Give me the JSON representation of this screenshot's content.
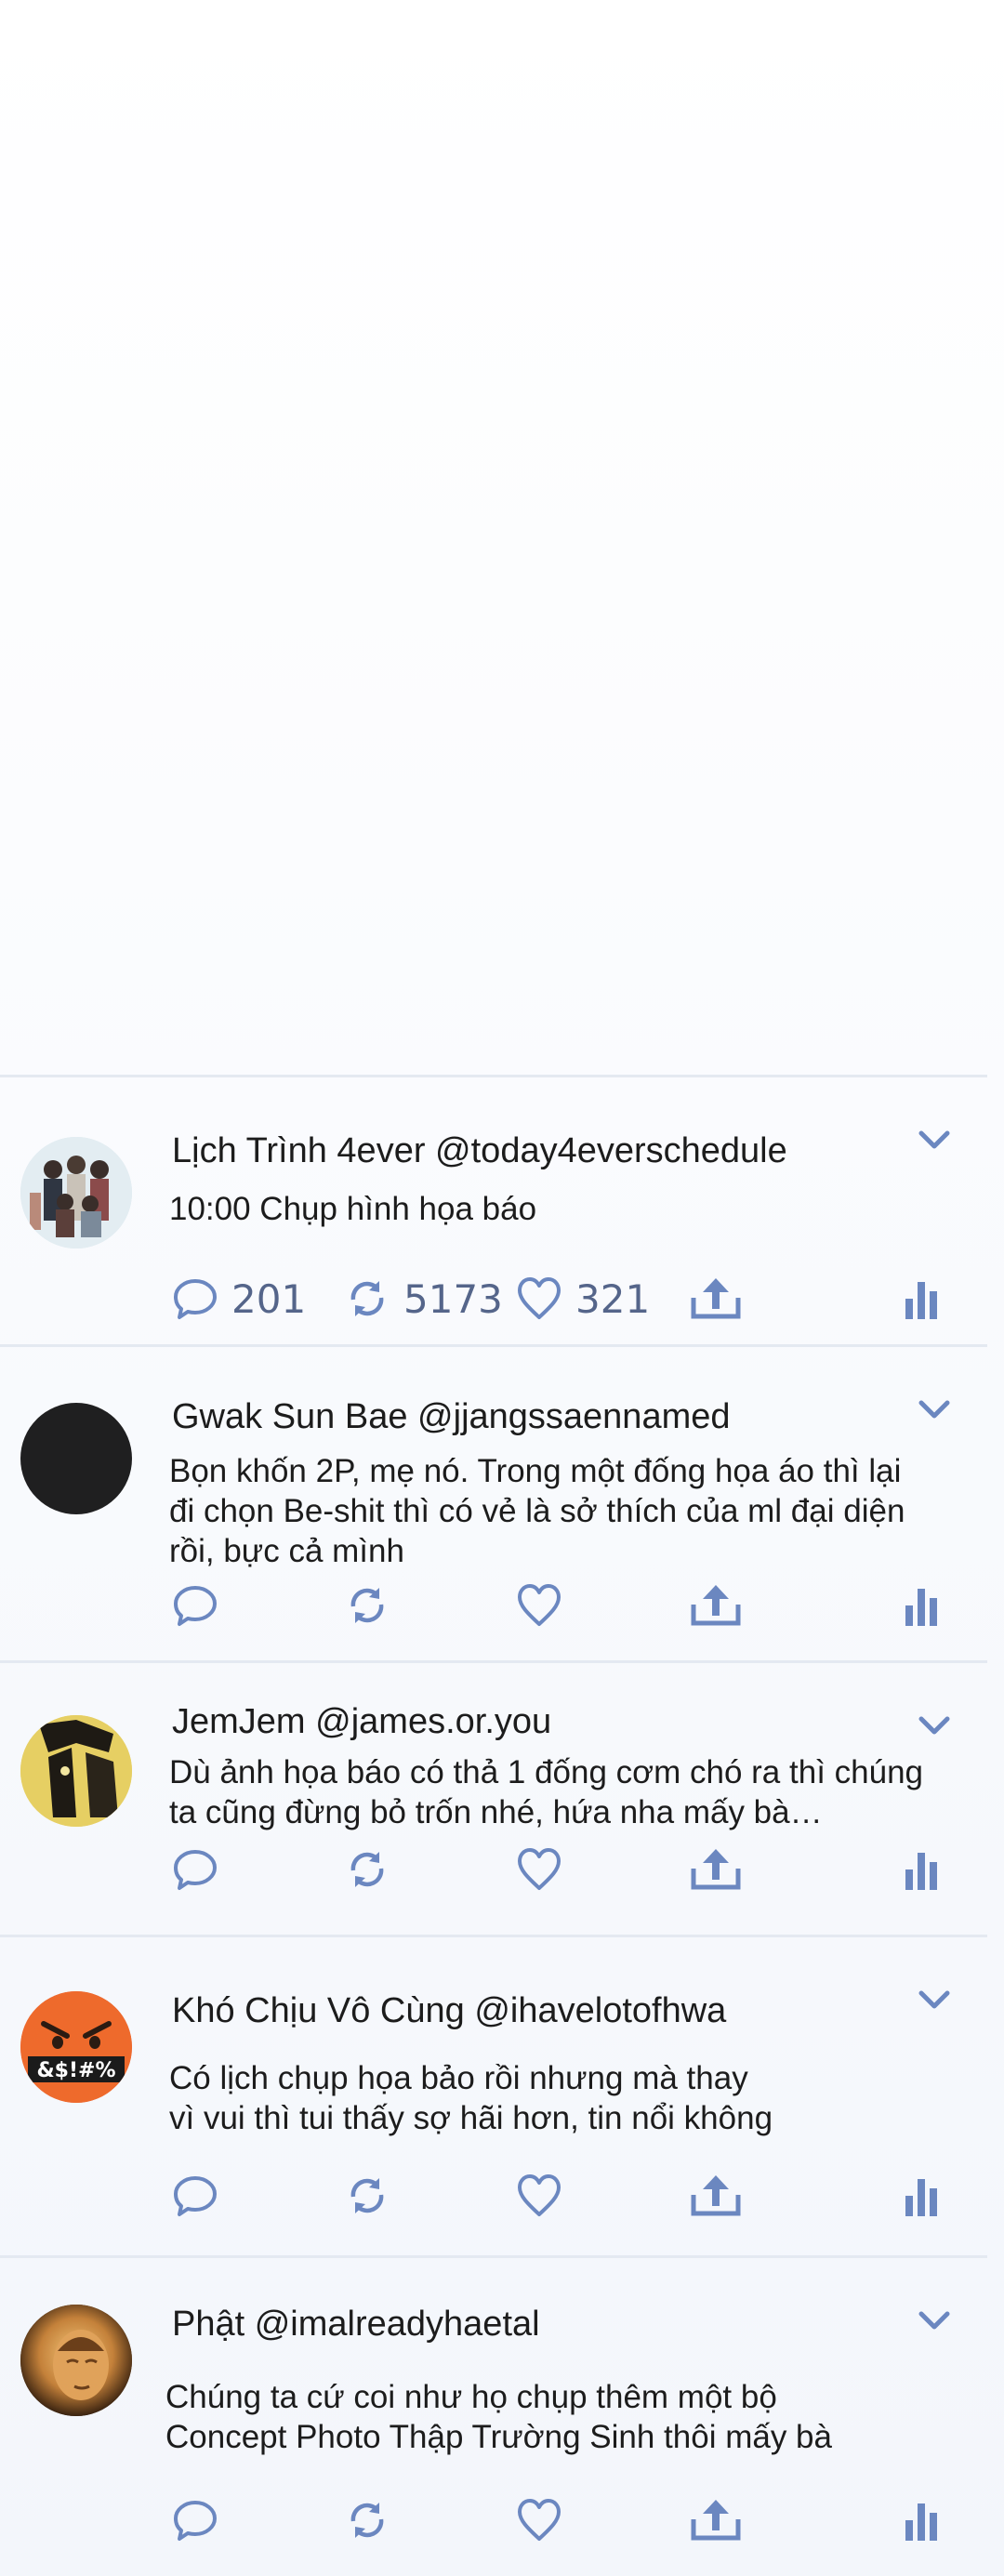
{
  "tweets": [
    {
      "name": "Lịch Trình 4ever",
      "handle": "@today4everschedule",
      "text": [
        "10:00 Chụp hình họa báo"
      ],
      "avatar": "group-photo-avatar",
      "stats": {
        "replies": "201",
        "retweets": "5173",
        "likes": "321"
      }
    },
    {
      "name": "Gwak Sun Bae",
      "handle": "@jjangssaennamed",
      "text": [
        "Bọn khốn 2P, mẹ nó. Trong một đống họa áo thì lại",
        "đi chọn Be-shit thì có vẻ là sở thích của ml đại diện",
        "rồi, bực cả mình"
      ],
      "avatar": "black-circle-avatar"
    },
    {
      "name": "JemJem",
      "handle": "@james.or.you",
      "text": [
        "Dù ảnh họa báo có thả 1 đống cơm chó ra thì chúng",
        "ta cũng đừng bỏ trốn nhé, hứa nha mấy bà…"
      ],
      "avatar": "cartoon-avatar"
    },
    {
      "name": "Khó Chịu Vô Cùng",
      "handle": "@ihavelotofhwa",
      "text": [
        "Có lịch chụp họa bảo rồi nhưng mà thay",
        "vì vui thì tui thấy sợ hãi hơn, tin nổi không"
      ],
      "avatar": "cursing-face-avatar",
      "avatar_symbols": "&$!#%"
    },
    {
      "name": "Phật",
      "handle": "@imalreadyhaetal",
      "text": [
        "Chúng ta cứ coi như họ chụp thêm một bộ",
        "Concept Photo Thập Trường Sinh thôi mấy bà"
      ],
      "avatar": "buddha-avatar"
    }
  ],
  "icons": {
    "reply": "reply-icon",
    "retweet": "retweet-icon",
    "like": "heart-icon",
    "share": "share-icon",
    "analytics": "analytics-icon",
    "menu": "chevron-down-icon"
  },
  "colors": {
    "icon": "#6b87c0",
    "divider": "#e4e9f1",
    "text": "#1c1c1c",
    "count": "#55658a"
  }
}
